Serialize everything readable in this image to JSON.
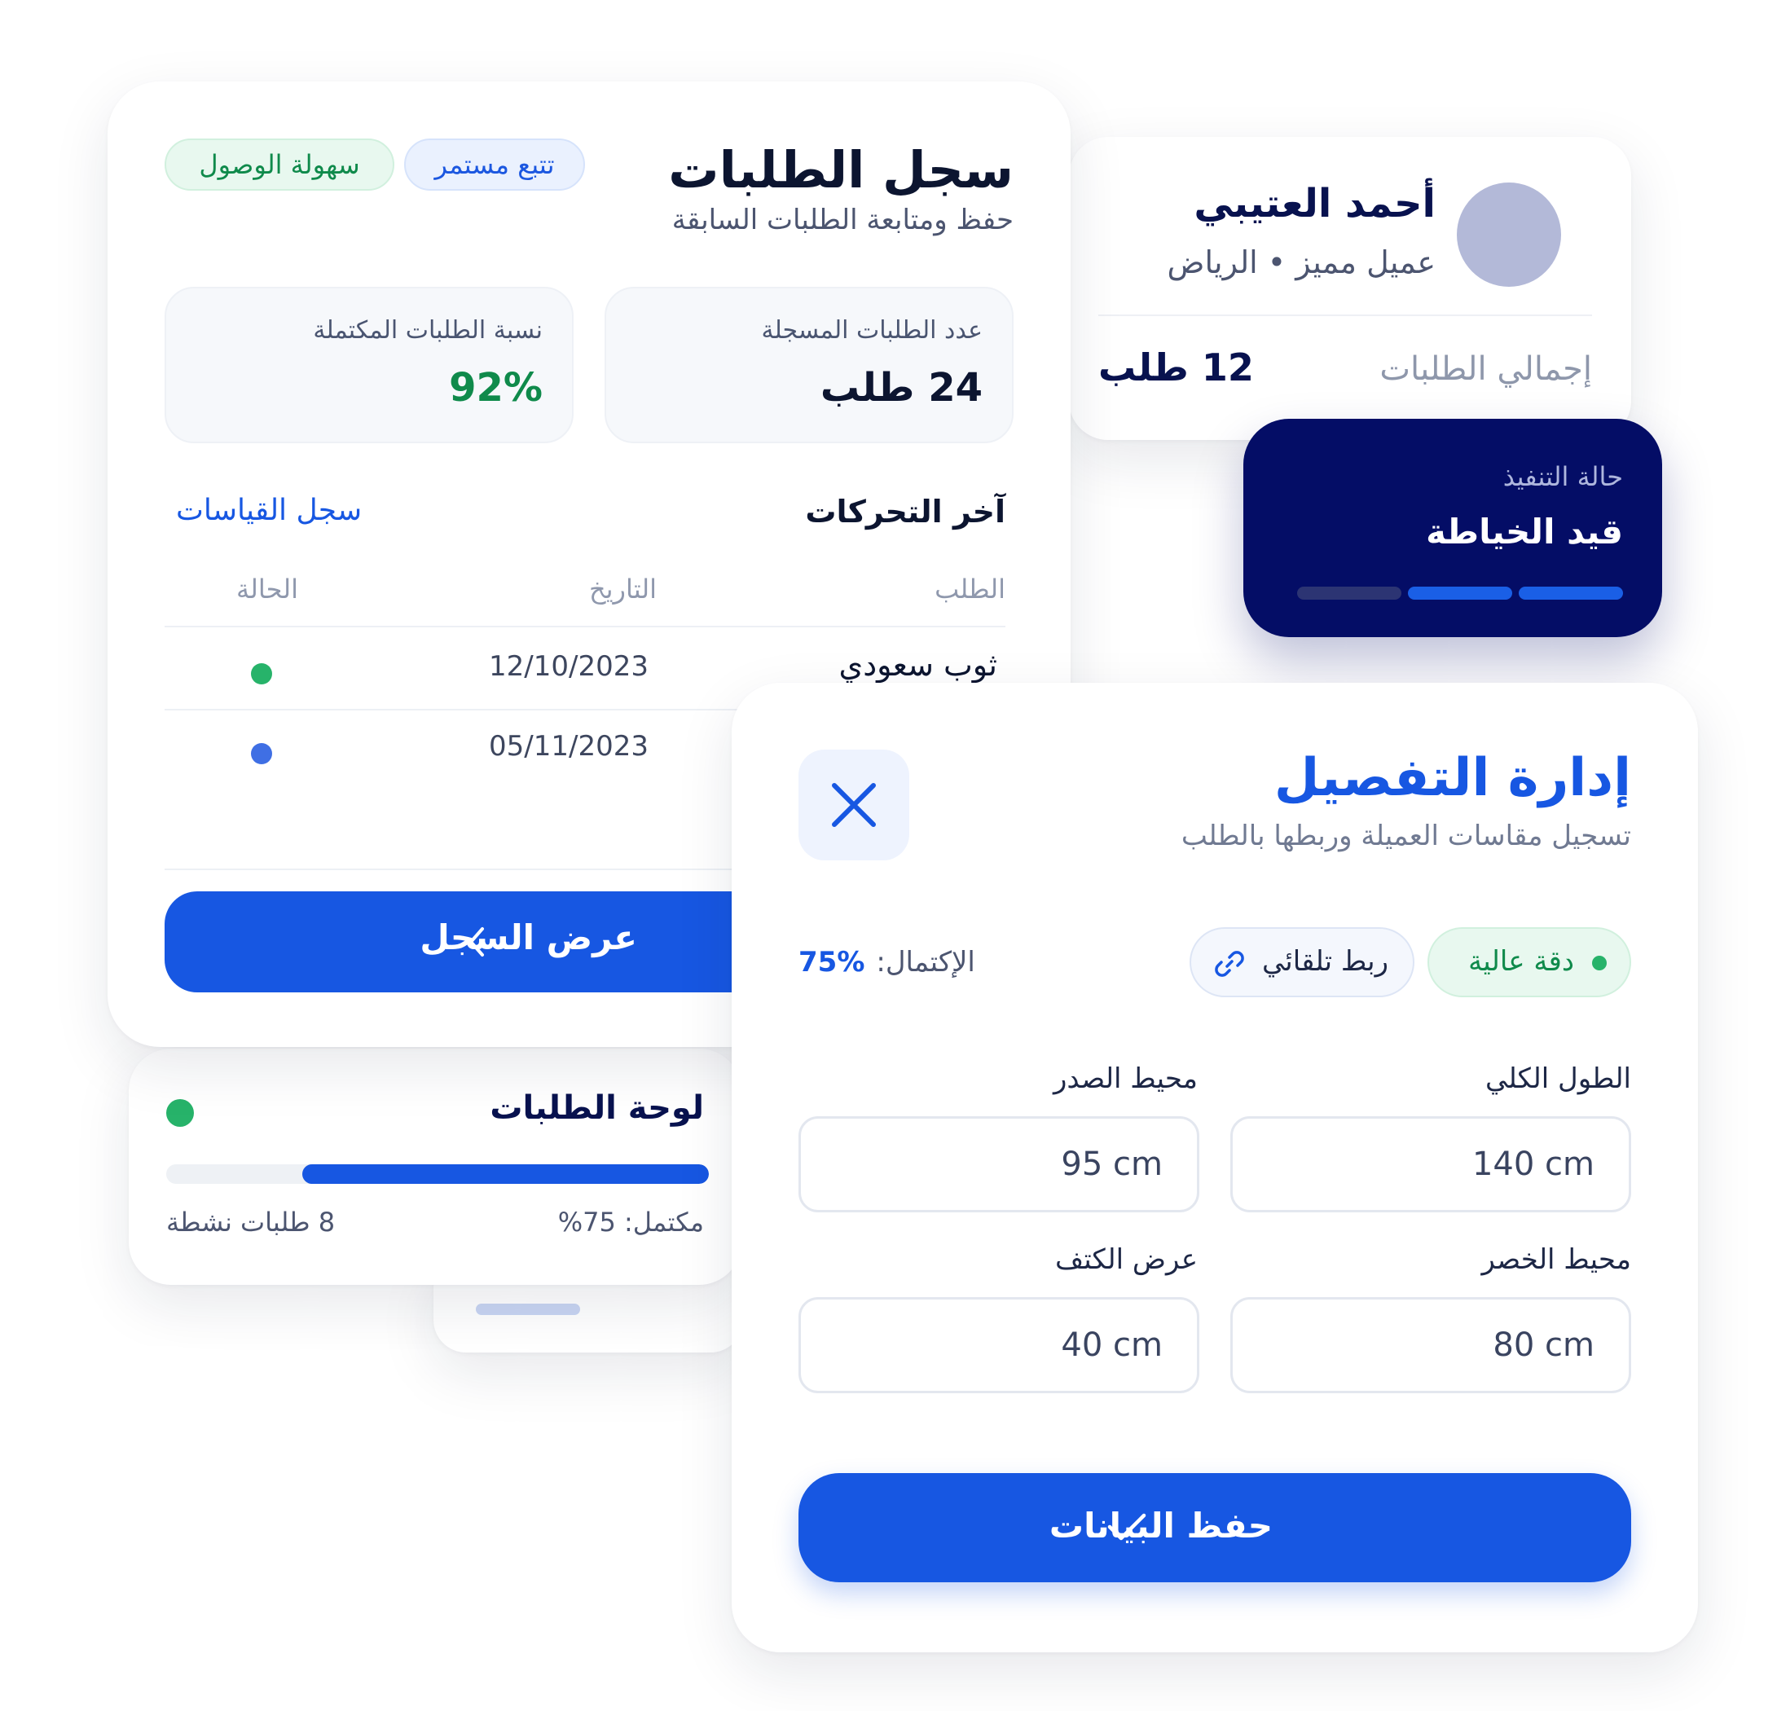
{
  "orders_log": {
    "title": "سجل الطلبات",
    "subtitle": "حفظ ومتابعة الطلبات السابقة",
    "tags": [
      "تتبع مستمر",
      "سهولة الوصول"
    ],
    "stats": [
      {
        "label": "عدد الطلبات المسجلة",
        "value": "24 طلب"
      },
      {
        "label": "نسبة الطلبات المكتملة",
        "value": "92%"
      }
    ],
    "recent_title": "آخر التحركات",
    "measurements_link": "سجل القياسات",
    "columns": [
      "الطلب",
      "التاريخ",
      "الحالة"
    ],
    "rows": [
      {
        "item": "ثوب سعودي",
        "date": "12/10/2023",
        "status_color": "#27b36a"
      },
      {
        "item": "",
        "date": "05/11/2023",
        "status_color": "#3f6fe4"
      }
    ],
    "view_button": "عرض السجل"
  },
  "customer": {
    "name": "أحمد العتيبي",
    "meta": "عميل مميز • الرياض",
    "total_label": "إجمالي الطلبات",
    "total_value": "12 طلب"
  },
  "execution_status": {
    "label": "حالة التنفيذ",
    "value": "قيد الخياطة",
    "steps_done": 2,
    "steps_total": 3
  },
  "orders_board": {
    "title": "لوحة الطلبات",
    "progress": 0.75,
    "completed_text": "مكتمل: 75%",
    "active_text": "8 طلبات نشطة",
    "status_color": "#27b36a"
  },
  "tailoring": {
    "title": "إدارة التفصيل",
    "subtitle": "تسجيل مقاسات العميلة وربطها بالطلب",
    "badge_accuracy": "دقة عالية",
    "badge_link": "ربط تلقائي",
    "completion_label": "الإكتمال:",
    "completion_value": "75%",
    "fields": [
      {
        "label": "الطول الكلي",
        "value": "140 cm"
      },
      {
        "label": "محيط الصدر",
        "value": "95 cm"
      },
      {
        "label": "محيط الخصر",
        "value": "80 cm"
      },
      {
        "label": "عرض الكتف",
        "value": "40 cm"
      }
    ],
    "save_button": "حفظ البيانات"
  },
  "colors": {
    "primary": "#1757e2",
    "navy": "#040d66",
    "green": "#0f8a4b",
    "avatar": "#b3b9d8"
  },
  "icons": [
    "chevron-left-icon",
    "close-icon",
    "link-icon",
    "check-icon",
    "status-dot"
  ]
}
